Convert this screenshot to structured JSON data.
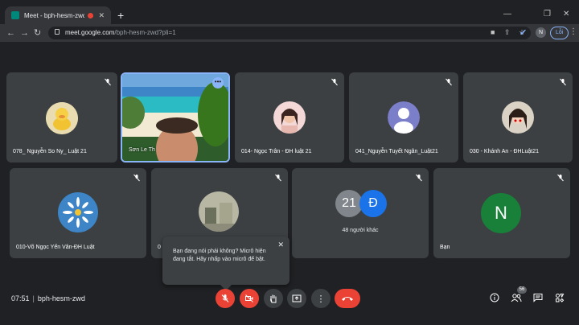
{
  "browser": {
    "tab_title": "Meet - bph-hesm-zwd",
    "url_host": "meet.google.com",
    "url_path": "/bph-hesm-zwd?pli=1",
    "profile_initial": "N",
    "error_label": "Lỗi"
  },
  "participants": [
    {
      "name": "078_ Nguyễn So Ny_ Luật 21",
      "avatar": "duck"
    },
    {
      "name": "Sơn Le Th",
      "avatar": "beach-video"
    },
    {
      "name": "014- Ngọc Trân - ĐH luật 21",
      "avatar": "photo"
    },
    {
      "name": "041_Nguyễn Tuyết Ngân_Luật21",
      "avatar": "default-person"
    },
    {
      "name": "030 - Khánh An - ĐHLuật21",
      "avatar": "photo"
    },
    {
      "name": "010-Võ Ngọc Yến Vân-ĐH Luật",
      "avatar": "flower"
    },
    {
      "name": "0",
      "avatar": "photo"
    },
    {
      "name": "Bạn",
      "avatar": "letter",
      "letter": "N"
    }
  ],
  "others_tile": {
    "count_badge": "21",
    "letter": "Đ",
    "label": "48 người khác"
  },
  "toast": {
    "message": "Bạn đang nói phải không? Micrô hiện đang tắt. Hãy nhấp vào micrô để bật."
  },
  "bottom_bar": {
    "time": "07:51",
    "meeting_code": "bph-hesm-zwd",
    "people_count": "56"
  },
  "colors": {
    "background": "#202124",
    "tile": "#3c4043",
    "danger": "#ea4335",
    "others_avatar_blue": "#1a73e8",
    "self_avatar_green": "#188038"
  }
}
